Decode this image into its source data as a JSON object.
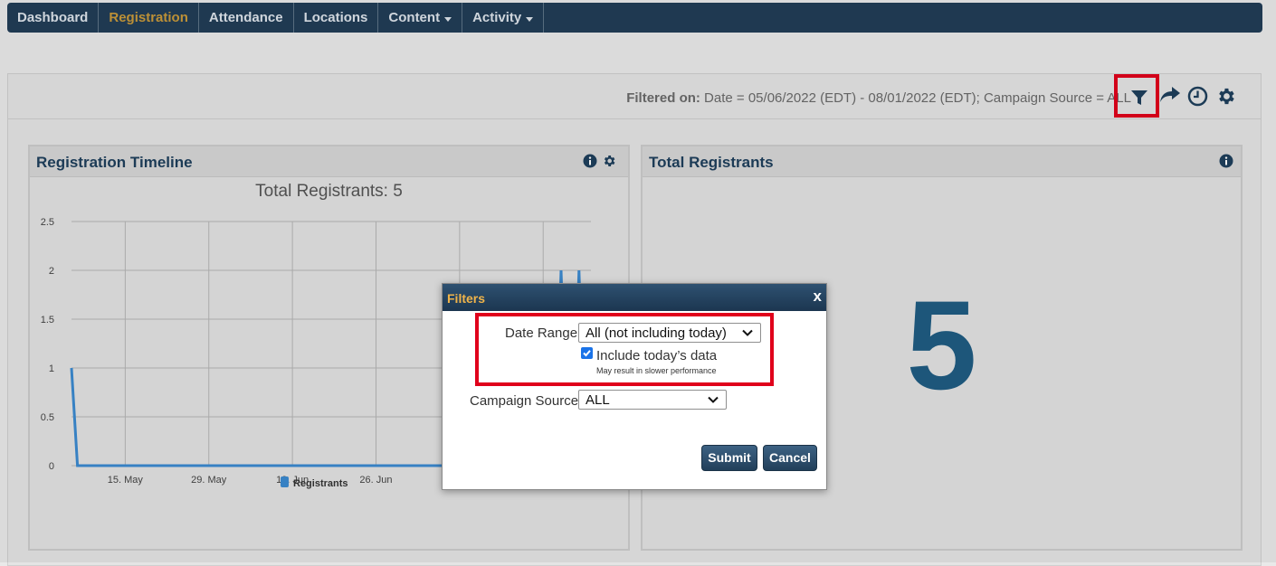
{
  "nav": {
    "items": [
      {
        "label": "Dashboard"
      },
      {
        "label": "Registration",
        "active": true
      },
      {
        "label": "Attendance"
      },
      {
        "label": "Locations"
      },
      {
        "label": "Content",
        "dropdown": true
      },
      {
        "label": "Activity",
        "dropdown": true
      }
    ]
  },
  "filterbar": {
    "prefix": "Filtered on:",
    "text": " Date = 05/06/2022 (EDT) - 08/01/2022 (EDT); Campaign Source = ALL",
    "icons": [
      "filter-icon",
      "share-arrow-icon",
      "clock-icon",
      "gear-icon"
    ]
  },
  "timeline": {
    "title": "Registration Timeline",
    "icons": [
      "info-icon",
      "gear-icon"
    ]
  },
  "chart_data": {
    "type": "line",
    "title": "Total Registrants: 5",
    "series": [
      {
        "name": "Registrants",
        "color": "#3b8ad0",
        "points": [
          [
            "2022-05-06",
            1
          ],
          [
            "2022-05-07",
            0
          ],
          [
            "2022-07-26",
            0
          ],
          [
            "2022-07-27",
            2
          ],
          [
            "2022-07-28",
            0
          ],
          [
            "2022-07-29",
            0
          ],
          [
            "2022-07-30",
            2
          ],
          [
            "2022-07-31",
            0
          ],
          [
            "2022-08-01",
            0
          ]
        ]
      }
    ],
    "xticks": [
      "15. May",
      "29. May",
      "12. Jun",
      "26. Jun"
    ],
    "ylim": [
      0,
      2.5
    ],
    "yticks": [
      "0",
      "0.5",
      "1",
      "1.5",
      "2",
      "2.5"
    ],
    "legend": "bottom"
  },
  "total": {
    "title": "Total Registrants",
    "value": "5",
    "icon": "info-icon"
  },
  "dialog": {
    "title": "Filters",
    "close": "x",
    "date_range_label": "Date Range",
    "date_range_value": "All (not including today)",
    "include_today_label": "Include today’s data",
    "include_today_checked": true,
    "slow_note": "May result in slower performance",
    "campaign_label": "Campaign Source",
    "campaign_value": "ALL",
    "submit": "Submit",
    "cancel": "Cancel"
  },
  "colors": {
    "nav_bg": "#213d57",
    "nav_active": "#c99a3a",
    "highlight": "#e0001b",
    "big_number": "#1f5c82",
    "series": "#3b8ad0"
  }
}
